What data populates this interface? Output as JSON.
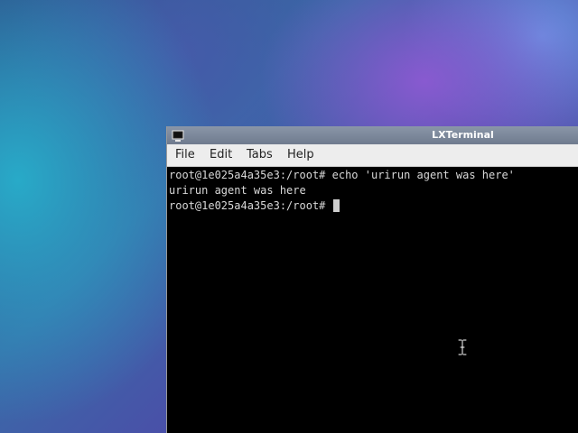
{
  "window": {
    "title": "LXTerminal"
  },
  "menu": {
    "items": [
      "File",
      "Edit",
      "Tabs",
      "Help"
    ]
  },
  "terminal": {
    "lines": [
      "root@1e025a4a35e3:/root# echo 'urirun agent was here'",
      "urirun agent was here",
      "root@1e025a4a35e3:/root# "
    ]
  },
  "icons": {
    "window_icon": "terminal-icon",
    "pointer": "text-cursor-icon"
  },
  "colors": {
    "titlebar": "#7b879a",
    "menubar": "#ededed",
    "terminal_bg": "#000000",
    "terminal_fg": "#d8d8d8"
  }
}
